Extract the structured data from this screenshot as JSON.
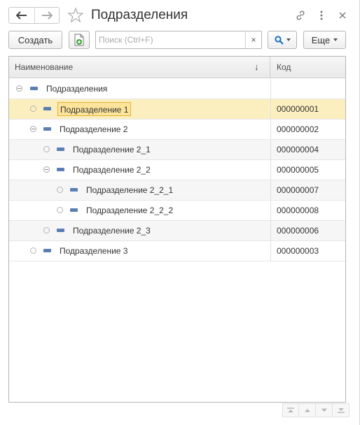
{
  "window": {
    "title": "Подразделения"
  },
  "toolbar": {
    "create_label": "Создать",
    "search_placeholder": "Поиск (Ctrl+F)",
    "search_value": "",
    "clear_label": "×",
    "more_label": "Еще"
  },
  "table": {
    "columns": {
      "name": "Наименование",
      "code": "Код"
    },
    "sort_indicator": "↓",
    "rows": [
      {
        "name": "Подразделения",
        "code": "",
        "level": 0,
        "type": "group-open",
        "selected": false
      },
      {
        "name": "Подразделение 1",
        "code": "000000001",
        "level": 1,
        "type": "leaf",
        "selected": true
      },
      {
        "name": "Подразделение 2",
        "code": "000000002",
        "level": 1,
        "type": "group-open",
        "selected": false
      },
      {
        "name": "Подразделение 2_1",
        "code": "000000004",
        "level": 2,
        "type": "leaf",
        "selected": false
      },
      {
        "name": "Подразделение 2_2",
        "code": "000000005",
        "level": 2,
        "type": "group-open",
        "selected": false
      },
      {
        "name": "Подразделение 2_2_1",
        "code": "000000007",
        "level": 3,
        "type": "leaf",
        "selected": false
      },
      {
        "name": "Подразделение 2_2_2",
        "code": "000000008",
        "level": 3,
        "type": "leaf",
        "selected": false
      },
      {
        "name": "Подразделение 2_3",
        "code": "000000006",
        "level": 2,
        "type": "leaf",
        "selected": false
      },
      {
        "name": "Подразделение 3",
        "code": "000000003",
        "level": 1,
        "type": "leaf",
        "selected": false
      }
    ]
  },
  "colors": {
    "selection": "#fcefbf",
    "selection_border": "#e5b13a",
    "item_icon": "#5b7fb3",
    "find_icon": "#1f6fc5",
    "copy_icon_green": "#3aa43a"
  },
  "icons": {
    "back": "arrow-left-icon",
    "forward": "arrow-right-icon",
    "favorite": "star-icon",
    "link": "link-icon",
    "menu": "more-vertical-icon",
    "close": "close-icon",
    "copy": "copy-document-icon",
    "find": "magnifier-icon",
    "scroll": [
      "scroll-top-icon",
      "scroll-up-icon",
      "scroll-down-icon",
      "scroll-bottom-icon"
    ]
  }
}
